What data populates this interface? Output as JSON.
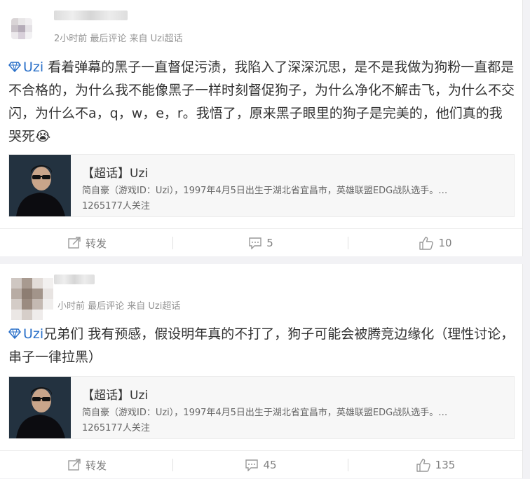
{
  "posts": [
    {
      "meta": "2小时前  最后评论  来自 Uzi超话",
      "topic_tag": "Uzi",
      "text": "看着弹幕的黑子一直督促污渍，我陷入了深深沉思，是不是我做为狗粉一直都是不合格的，为什么我不能像黑子一样时刻督促狗子，为什么净化不解击飞，为什么不交闪，为什么不a，q，w，e，r。我悟了，原来黑子眼里的狗子是完美的，他们真的我哭死",
      "emoji": "😭",
      "card": {
        "title": "【超话】Uzi",
        "desc": "简自豪（游戏ID：Uzi），1997年4月5日出生于湖北省宜昌市，英雄联盟EDG战队选手。…",
        "followers": "1265177人关注"
      },
      "actions": {
        "repost": "转发",
        "comments": "5",
        "likes": "10"
      }
    },
    {
      "meta": "小时前  最后评论  来自 Uzi超话",
      "topic_tag": "Uzi",
      "text": "兄弟们 我有预感，假设明年真的不打了，狗子可能会被腾竞边缘化（理性讨论，串子一律拉黑）",
      "emoji": "",
      "card": {
        "title": "【超话】Uzi",
        "desc": "简自豪（游戏ID：Uzi），1997年4月5日出生于湖北省宜昌市，英雄联盟EDG战队选手。…",
        "followers": "1265177人关注"
      },
      "actions": {
        "repost": "转发",
        "comments": "45",
        "likes": "135"
      }
    }
  ],
  "icons": {
    "repost": "repost-icon",
    "comment": "comment-icon",
    "like": "like-icon",
    "tag": "diamond-icon"
  },
  "colors": {
    "link": "#2a70c9",
    "meta": "#939393",
    "action": "#808080"
  }
}
